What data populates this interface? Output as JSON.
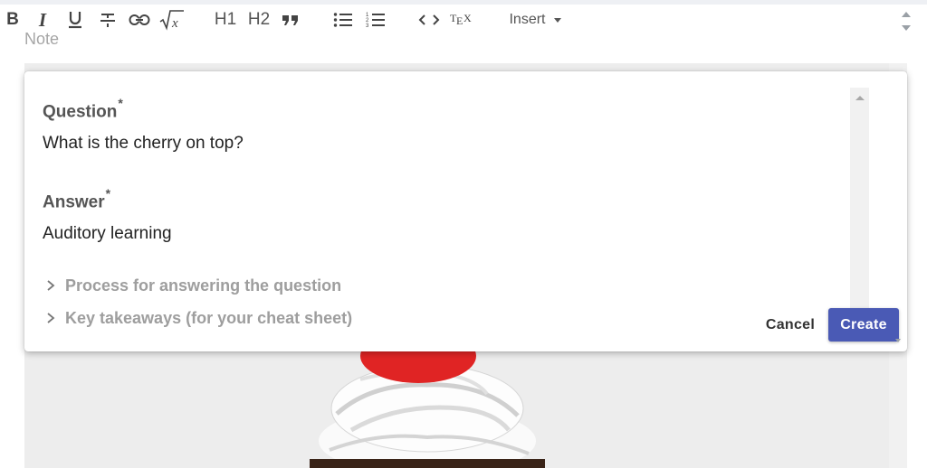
{
  "toolbar": {
    "buttons": [
      {
        "name": "bold",
        "icon": "bold-icon"
      },
      {
        "name": "italic",
        "icon": "italic-icon"
      },
      {
        "name": "underline",
        "icon": "underline-icon"
      },
      {
        "name": "strikethrough",
        "icon": "strikethrough-icon"
      },
      {
        "name": "link",
        "icon": "link-icon"
      },
      {
        "name": "formula",
        "icon": "sqrt-x-icon"
      },
      {
        "name": "unordered-list",
        "icon": "bullet-list-icon"
      },
      {
        "name": "ordered-list",
        "icon": "numbered-list-icon"
      },
      {
        "name": "code",
        "icon": "code-icon"
      },
      {
        "name": "tex",
        "icon": "tex-icon"
      }
    ],
    "h1_label": "H1",
    "h2_label": "H2",
    "quote_label": "❞",
    "insert_label": "Insert"
  },
  "editor": {
    "note_label": "Note"
  },
  "dialog": {
    "question_label": "Question",
    "question_required": "*",
    "question_value": "What is the cherry on top?",
    "answer_label": "Answer",
    "answer_required": "*",
    "answer_value": "Auditory learning",
    "expanders": [
      {
        "label": "Process for answering the question"
      },
      {
        "label": "Key takeaways (for your cheat sheet)"
      }
    ],
    "cancel_label": "Cancel",
    "create_label": "Create"
  },
  "colors": {
    "primary": "#4a5ab5",
    "label_gray": "#555555",
    "muted_gray": "#9e9e9e",
    "editor_bg": "#ededed",
    "cherry": "#e02424"
  }
}
